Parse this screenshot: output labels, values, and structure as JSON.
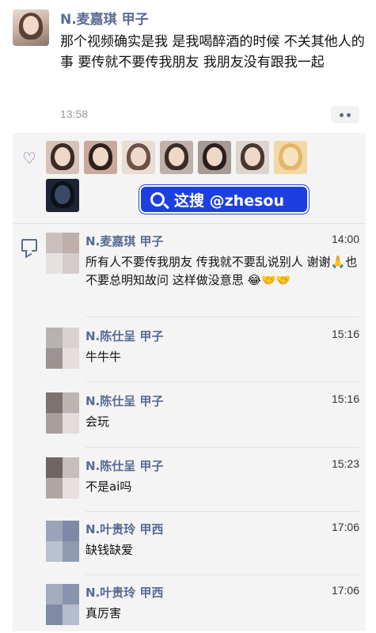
{
  "post": {
    "author": "N.麦嘉琪 甲子",
    "text": "那个视频确实是我 是我喝醉酒的时候 不关其他人的事 要传就不要传我朋友 我朋友没有跟我一起",
    "time": "13:58"
  },
  "watermark": {
    "text": "这搜 @zhesou"
  },
  "icons": {
    "like": "heart-icon",
    "comment": "comment-icon",
    "more": "more-dots-icon",
    "search": "search-icon"
  },
  "comments": [
    {
      "author": "N.麦嘉琪 甲子",
      "time": "14:00",
      "text": "所有人不要传我朋友 传我就不要乱说别人 谢谢🙏也不要总明知故问 这样做没意思 😂🤝🤝"
    },
    {
      "author": "N.陈仕呈 甲子",
      "time": "15:16",
      "text": "牛牛牛"
    },
    {
      "author": "N.陈仕呈 甲子",
      "time": "15:16",
      "text": "会玩"
    },
    {
      "author": "N.陈仕呈 甲子",
      "time": "15:23",
      "text": "不是ai吗"
    },
    {
      "author": "N.叶贵玲 甲西",
      "time": "17:06",
      "text": "缺钱缺爱"
    },
    {
      "author": "N.叶贵玲 甲西",
      "time": "17:06",
      "text": "真厉害"
    }
  ],
  "colors": {
    "name": "#576b95",
    "badge": "#1d3fe0"
  }
}
